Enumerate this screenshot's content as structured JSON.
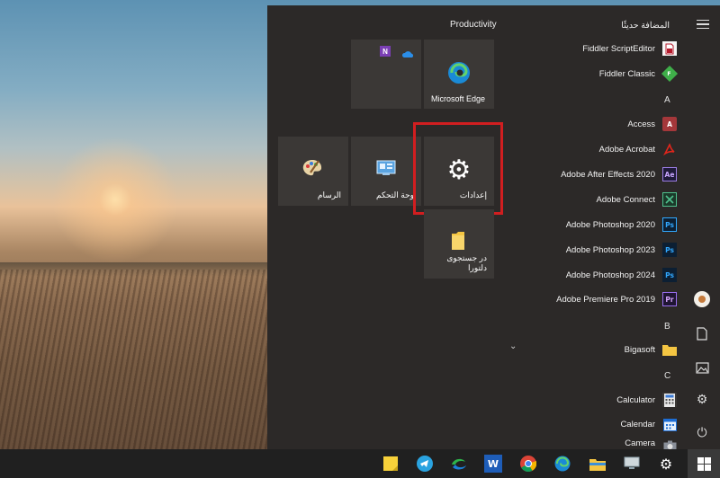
{
  "start_menu": {
    "group_title": "Productivity",
    "tiles": {
      "edge": "Microsoft Edge",
      "paint": "الرسام",
      "control_panel": "وحة التحكم",
      "settings": "إعدادات",
      "folder": "در جستجوی دلتورا"
    },
    "app_list": {
      "recent_header": "المضافة حديثًا",
      "fiddler_scripteditor": "Fiddler ScriptEditor",
      "fiddler_classic": "Fiddler Classic",
      "letter_a": "A",
      "access": "Access",
      "adobe_acrobat": "Adobe Acrobat",
      "after_effects": "Adobe After Effects 2020",
      "adobe_connect": "Adobe Connect",
      "ps_2020": "Adobe Photoshop 2020",
      "ps_2023": "Adobe Photoshop 2023",
      "ps_2024": "Adobe Photoshop 2024",
      "premiere": "Adobe Premiere Pro 2019",
      "letter_b": "B",
      "bigasoft": "Bigasoft",
      "letter_c": "C",
      "calculator": "Calculator",
      "calendar": "Calendar",
      "camera": "Camera"
    },
    "icon_text": {
      "ae": "Ae",
      "ps": "Ps",
      "pr": "Pr",
      "access": "A",
      "fiddler": "F",
      "word": "W",
      "onenote": "N"
    }
  },
  "icons": {
    "menu": "hamburger-icon",
    "avatar": "user-avatar",
    "documents": "document-icon",
    "pictures": "picture-icon",
    "settings": "gear-icon",
    "power": "power-icon"
  },
  "colors": {
    "highlight": "#d11e20",
    "menu_bg": "#2c2928",
    "tile_bg": "#3b3836",
    "taskbar_bg": "#202020"
  }
}
